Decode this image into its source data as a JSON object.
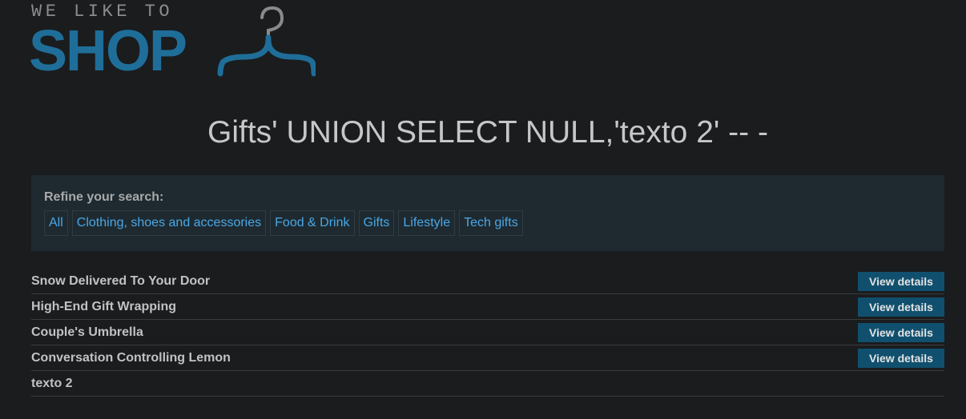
{
  "logo": {
    "tagline": "WE LIKE TO",
    "word": "SHOP",
    "hanger_icon": "hanger-icon"
  },
  "title": "Gifts' UNION SELECT NULL,'texto 2' -- -",
  "filter": {
    "label": "Refine your search:",
    "links": [
      "All",
      "Clothing, shoes and accessories",
      "Food & Drink",
      "Gifts",
      "Lifestyle",
      "Tech gifts"
    ]
  },
  "products": [
    {
      "name": "Snow Delivered To Your Door",
      "button": "View details"
    },
    {
      "name": "High-End Gift Wrapping",
      "button": "View details"
    },
    {
      "name": "Couple's Umbrella",
      "button": "View details"
    },
    {
      "name": "Conversation Controlling Lemon",
      "button": "View details"
    },
    {
      "name": "texto 2",
      "button": ""
    }
  ],
  "colors": {
    "background": "#1a1c1e",
    "brand": "#1f6e99",
    "link": "#4aa7e6",
    "button": "#10506e"
  }
}
